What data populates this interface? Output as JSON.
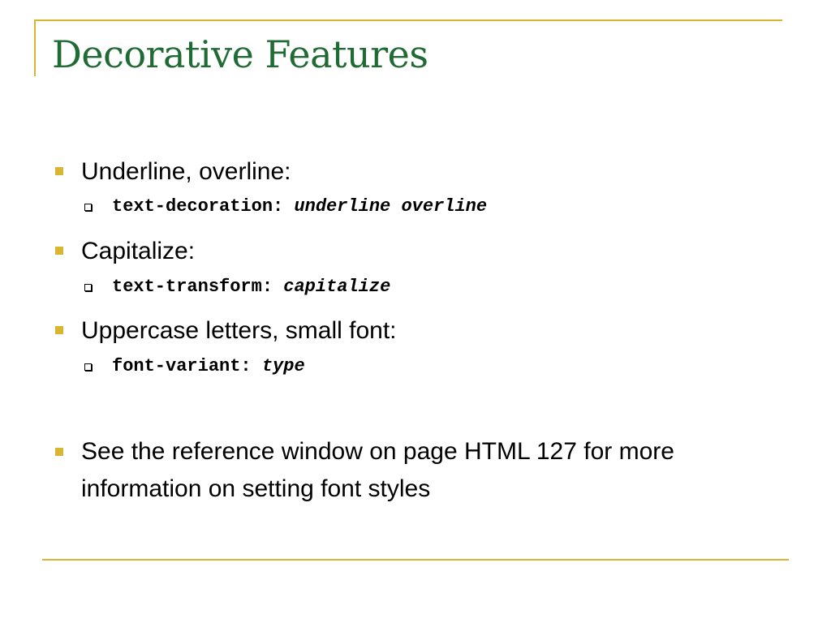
{
  "slide": {
    "title": "Decorative Features",
    "bullets": [
      {
        "text": "Underline, overline:",
        "sub": {
          "property": "text-decoration:",
          "value": "underline overline"
        }
      },
      {
        "text": "Capitalize:",
        "sub": {
          "property": "text-transform:",
          "value": "capitalize"
        }
      },
      {
        "text": "Uppercase letters, small font:",
        "sub": {
          "property": "font-variant:",
          "value": "type"
        }
      },
      {
        "text": "See the reference window on page HTML 127 for more information on setting font styles"
      }
    ]
  },
  "colors": {
    "title": "#1F6B33",
    "accent": "#D9B531",
    "text": "#000000"
  }
}
